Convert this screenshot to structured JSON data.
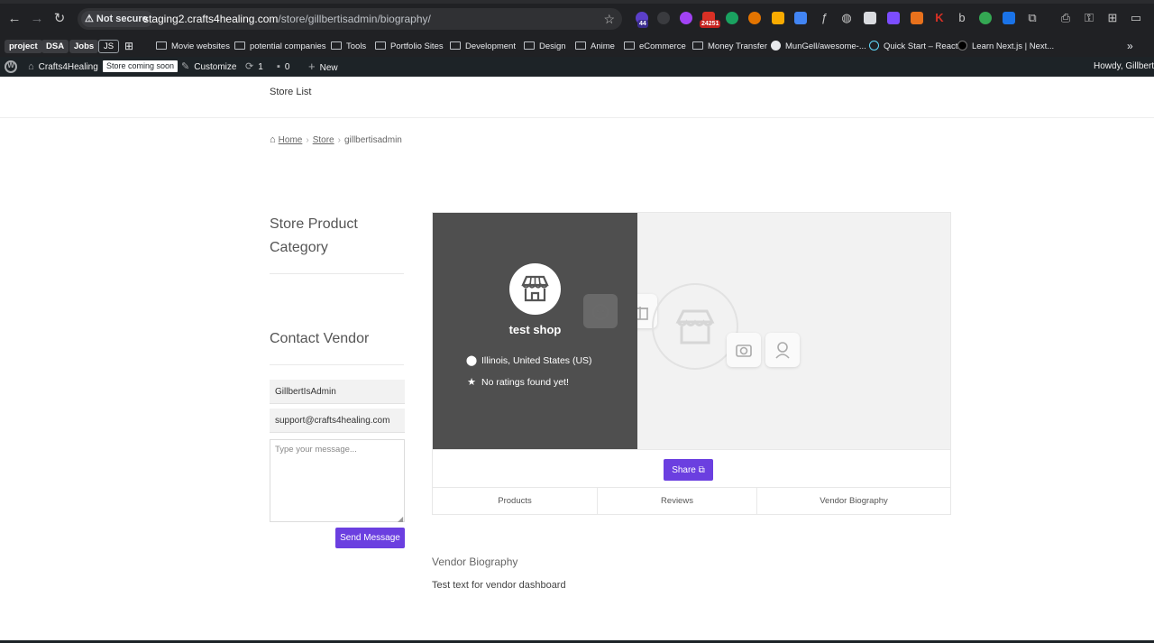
{
  "browser": {
    "security_label": "Not secure",
    "url_host": "staging2.crafts4healing.com",
    "url_path": "/store/gillbertisadmin/biography/",
    "extension_badges": [
      "44",
      "24251"
    ]
  },
  "bookmarks": {
    "pills": [
      "project",
      "DSA",
      "Jobs",
      "JS"
    ],
    "folders": [
      "Movie websites",
      "potential companies",
      "Tools",
      "Portfolio Sites",
      "Development",
      "Design",
      "Anime",
      "eCommerce",
      "Money Transfer"
    ],
    "links": [
      "MunGell/awesome-...",
      "Quick Start – React",
      "Learn Next.js | Next..."
    ],
    "more": "»"
  },
  "adminbar": {
    "site_name": "Crafts4Healing",
    "coming_soon": "Store coming soon",
    "customize": "Customize",
    "updates_count": "1",
    "comments_count": "0",
    "new_label": "New",
    "howdy": "Howdy, GillbertIsAdmin"
  },
  "nav": {
    "store_list": "Store List"
  },
  "breadcrumb": {
    "home": "Home",
    "store": "Store",
    "current": "gillbertisadmin"
  },
  "sidebar": {
    "category_title": "Store Product Category",
    "contact_title": "Contact Vendor",
    "name_value": "GillbertIsAdmin",
    "email_value": "support@crafts4healing.com",
    "message_placeholder": "Type your message...",
    "send_label": "Send Message"
  },
  "store": {
    "name": "test shop",
    "location": "Illinois, United States (US)",
    "rating": "No ratings found yet!",
    "share_label": "Share",
    "tabs": [
      "Products",
      "Reviews",
      "Vendor Biography"
    ]
  },
  "biography": {
    "heading": "Vendor Biography",
    "text": "Test text for vendor dashboard"
  },
  "colors": {
    "accent": "#6b3fe0",
    "store_panel": "#4f4f4f",
    "adminbar": "#1d2327"
  }
}
